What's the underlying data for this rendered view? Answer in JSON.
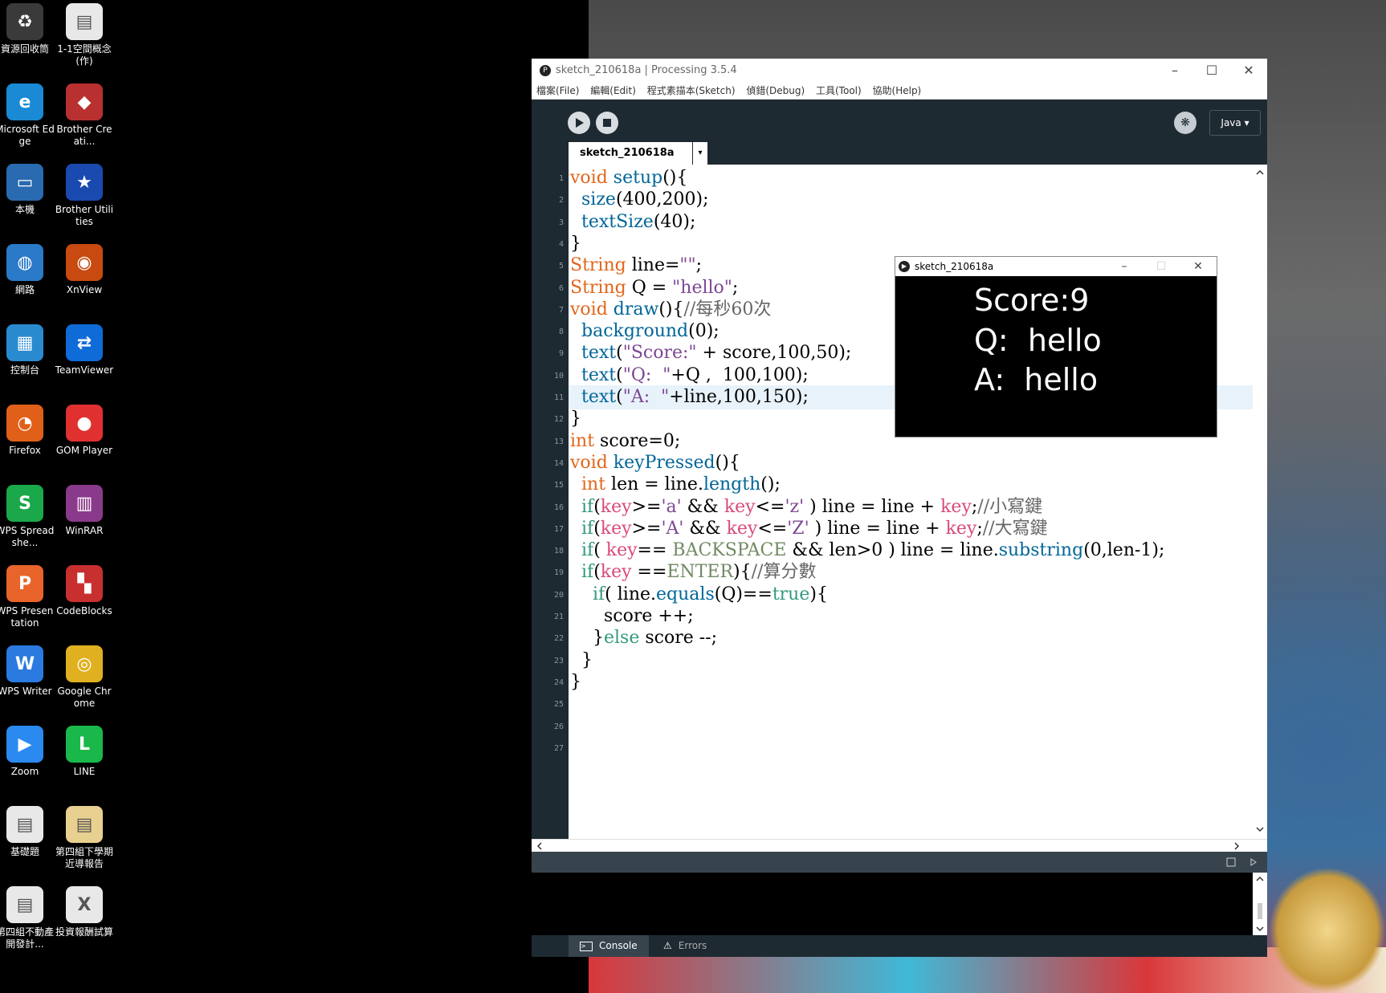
{
  "desktop": {
    "icons": [
      {
        "label": "資源回收筒",
        "color": "#3a3a3a",
        "glyph": "♻"
      },
      {
        "label": "1-1空間概念(作)",
        "color": "#e8e8e8",
        "glyph": "▤"
      },
      {
        "label": "Microsoft Edge",
        "color": "#1a8ad4",
        "glyph": "e"
      },
      {
        "label": "Brother Creati...",
        "color": "#b83030",
        "glyph": "◆"
      },
      {
        "label": "本機",
        "color": "#2a6ab0",
        "glyph": "▭"
      },
      {
        "label": "Brother Utilities",
        "color": "#1a4ab0",
        "glyph": "★"
      },
      {
        "label": "網路",
        "color": "#2a7ac8",
        "glyph": "◍"
      },
      {
        "label": "XnView",
        "color": "#c84a10",
        "glyph": "◉"
      },
      {
        "label": "控制台",
        "color": "#2a8ad0",
        "glyph": "▦"
      },
      {
        "label": "TeamViewer",
        "color": "#0e6bd8",
        "glyph": "⇄"
      },
      {
        "label": "Firefox",
        "color": "#e0601a",
        "glyph": "◔"
      },
      {
        "label": "GOM Player",
        "color": "#e03030",
        "glyph": "●"
      },
      {
        "label": "WPS Spreadshe...",
        "color": "#1aa84a",
        "glyph": "S"
      },
      {
        "label": "WinRAR",
        "color": "#8a3a8a",
        "glyph": "▥"
      },
      {
        "label": "WPS Presentation",
        "color": "#e8642a",
        "glyph": "P"
      },
      {
        "label": "CodeBlocks",
        "color": "#c83030",
        "glyph": "▚"
      },
      {
        "label": "WPS Writer",
        "color": "#2a7ae0",
        "glyph": "W"
      },
      {
        "label": "Google Chrome",
        "color": "#e0b020",
        "glyph": "◎"
      },
      {
        "label": "Zoom",
        "color": "#2a8af0",
        "glyph": "▶"
      },
      {
        "label": "LINE",
        "color": "#1ab84a",
        "glyph": "L"
      },
      {
        "label": "基礎題",
        "color": "#e8e8e8",
        "glyph": "▤"
      },
      {
        "label": "第四組下學期近導報告",
        "color": "#e8d090",
        "glyph": "▤"
      },
      {
        "label": "第四組不動產開發計...",
        "color": "#e8e8e8",
        "glyph": "▤"
      },
      {
        "label": "投資報酬試算",
        "color": "#e8e8e8",
        "glyph": "X"
      }
    ]
  },
  "processing": {
    "title": "sketch_210618a | Processing 3.5.4",
    "menu": [
      "檔案(File)",
      "編輯(Edit)",
      "程式素描本(Sketch)",
      "偵錯(Debug)",
      "工具(Tool)",
      "協助(Help)"
    ],
    "mode": "Java ▾",
    "tab": "sketch_210618a",
    "tab_arrow": "▾",
    "line_numbers": [
      "1",
      "2",
      "3",
      "4",
      "5",
      "6",
      "7",
      "8",
      "9",
      "10",
      "11",
      "12",
      "13",
      "14",
      "15",
      "16",
      "17",
      "18",
      "19",
      "20",
      "21",
      "22",
      "23",
      "24",
      "25",
      "26",
      "27"
    ],
    "bottom_tabs": {
      "console": "Console",
      "errors": "Errors"
    }
  },
  "sketch": {
    "title": "sketch_210618a",
    "score": "Score:9",
    "q": "Q:  hello",
    "a": "A:  hello"
  }
}
